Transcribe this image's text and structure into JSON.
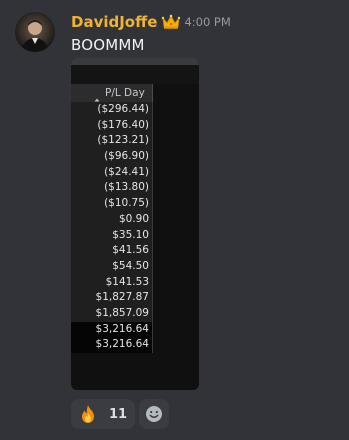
{
  "message": {
    "username": "DavidJoffe",
    "timestamp": "4:00 PM",
    "text": "BOOMMM"
  },
  "attachment": {
    "column_header": "P/L Day",
    "rows": [
      "($296.44)",
      "($176.40)",
      "($123.21)",
      "($96.90)",
      "($24.41)",
      "($13.80)",
      "($10.75)",
      "$0.90",
      "$35.10",
      "$41.56",
      "$54.50",
      "$141.53",
      "$1,827.87",
      "$1,857.09"
    ],
    "totals": [
      "$3,216.64",
      "$3,216.64"
    ]
  },
  "reactions": [
    {
      "icon": "fire-icon",
      "count": "11"
    }
  ],
  "icons": {
    "crown": "crown-icon",
    "sort": "sort-up-icon",
    "add_reaction": "smile-icon"
  },
  "colors": {
    "background": "#313338",
    "username": "#f0b232",
    "timestamp": "#949ba4",
    "reaction_bg": "#3a3c42"
  }
}
